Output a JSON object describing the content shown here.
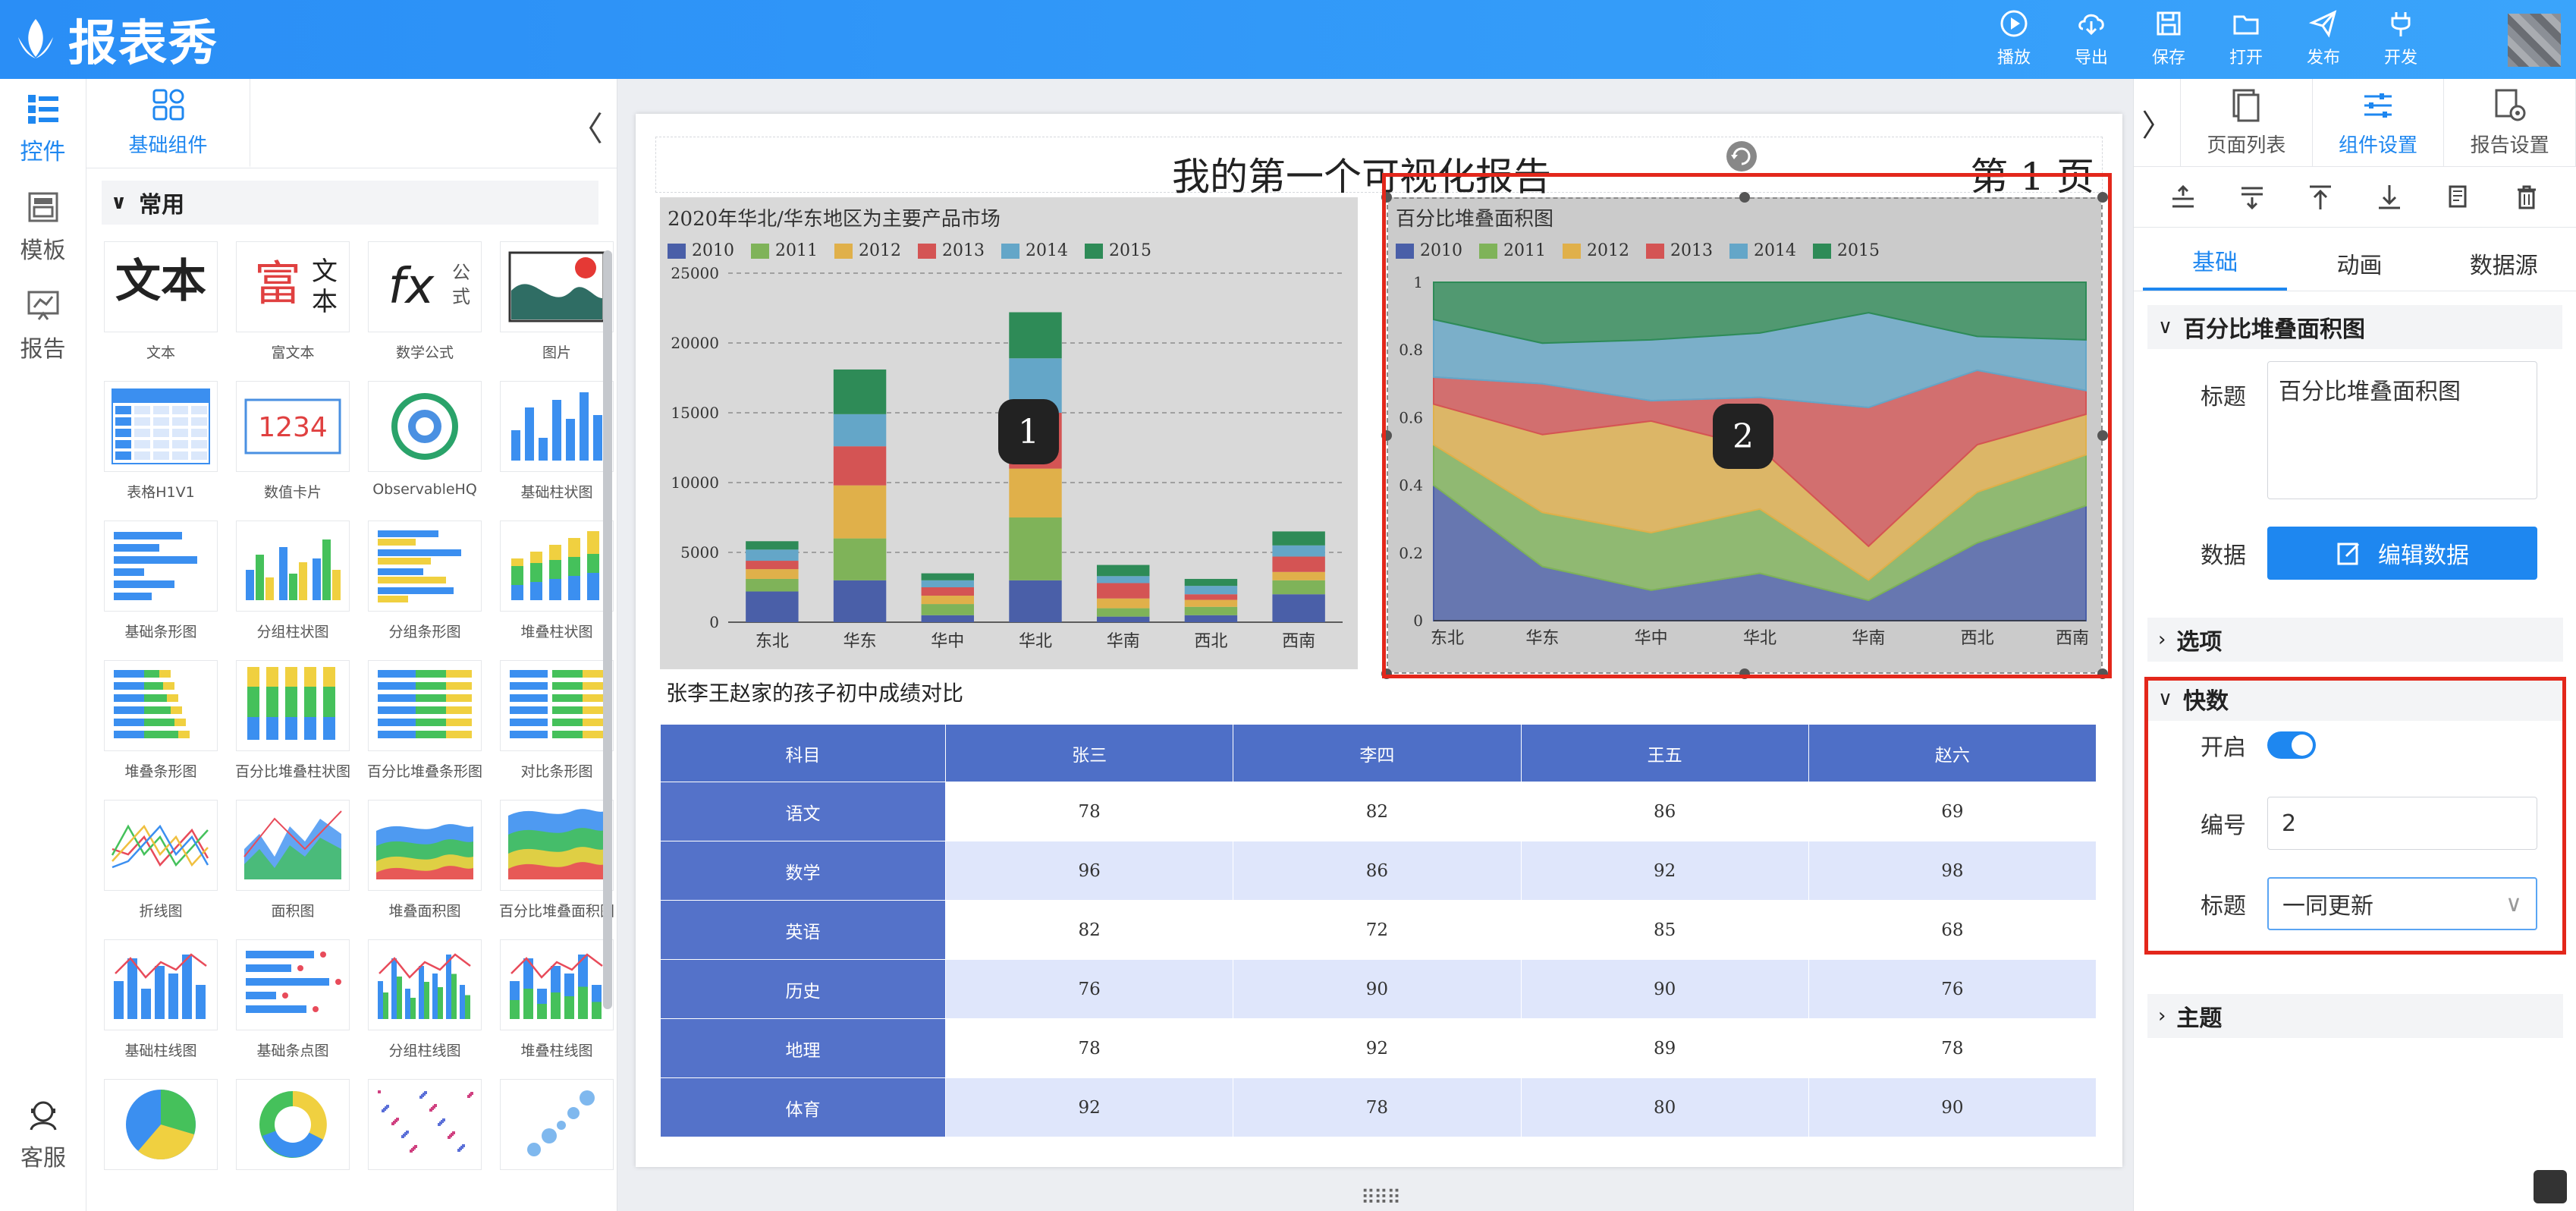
{
  "app": {
    "title": "报表秀"
  },
  "toolbar": [
    {
      "label": "播放",
      "icon": "play-icon"
    },
    {
      "label": "导出",
      "icon": "export-icon"
    },
    {
      "label": "保存",
      "icon": "save-icon"
    },
    {
      "label": "打开",
      "icon": "open-folder-icon"
    },
    {
      "label": "发布",
      "icon": "publish-icon"
    },
    {
      "label": "开发",
      "icon": "plug-icon"
    }
  ],
  "rail": {
    "items": [
      "控件",
      "模板",
      "报告"
    ],
    "bottom": "客服"
  },
  "components": {
    "tab": "基础组件",
    "section": "常用",
    "items": [
      "文本",
      "富文本",
      "数学公式",
      "图片",
      "表格H1V1",
      "数值卡片",
      "ObservableHQ",
      "基础柱状图",
      "基础条形图",
      "分组柱状图",
      "分组条形图",
      "堆叠柱状图",
      "堆叠条形图",
      "百分比堆叠柱状图",
      "百分比堆叠条形图",
      "对比条形图",
      "折线图",
      "面积图",
      "堆叠面积图",
      "百分比堆叠面积图",
      "基础柱线图",
      "基础条点图",
      "分组柱线图",
      "堆叠柱线图",
      "",
      "",
      "",
      ""
    ],
    "thumb_text": {
      "wenben": "文本",
      "fu": "富",
      "fu2": "文",
      "fu3": "本",
      "fx": "fx",
      "gongshi1": "公",
      "gongshi2": "式",
      "card": "1234"
    }
  },
  "report": {
    "title": "我的第一个可视化报告",
    "page_label": "第  1  页",
    "badges": [
      "1",
      "2"
    ]
  },
  "colors": {
    "2010": "#4a5fa8",
    "2011": "#7fb359",
    "2012": "#e0b04a",
    "2013": "#d45454",
    "2014": "#64a6c8",
    "2015": "#2e8b57",
    "accent": "#1e87f0",
    "highlight": "#e3271b"
  },
  "chart_data": [
    {
      "type": "bar",
      "stacked": true,
      "title": "2020年华北/华东地区为主要产品市场",
      "categories": [
        "东北",
        "华东",
        "华中",
        "华北",
        "华南",
        "西北",
        "西南"
      ],
      "series": [
        {
          "name": "2010",
          "values": [
            2200,
            3000,
            500,
            3000,
            400,
            500,
            2000
          ]
        },
        {
          "name": "2011",
          "values": [
            900,
            3000,
            800,
            4500,
            600,
            600,
            1000
          ]
        },
        {
          "name": "2012",
          "values": [
            700,
            3800,
            600,
            3500,
            700,
            500,
            600
          ]
        },
        {
          "name": "2013",
          "values": [
            600,
            2800,
            600,
            4000,
            1100,
            400,
            1100
          ]
        },
        {
          "name": "2014",
          "values": [
            800,
            2300,
            500,
            3900,
            500,
            600,
            800
          ]
        },
        {
          "name": "2015",
          "values": [
            600,
            3200,
            500,
            3300,
            800,
            500,
            1000
          ]
        }
      ],
      "yticks": [
        "0",
        "5000",
        "10000",
        "15000",
        "20000",
        "25000"
      ],
      "ylim": [
        0,
        25000
      ]
    },
    {
      "type": "area",
      "stacked": "percent",
      "title": "百分比堆叠面积图",
      "categories": [
        "东北",
        "华东",
        "华中",
        "华北",
        "华南",
        "西北",
        "西南"
      ],
      "series": [
        {
          "name": "2010",
          "values": [
            0.4,
            0.16,
            0.09,
            0.14,
            0.06,
            0.23,
            0.34
          ]
        },
        {
          "name": "2011",
          "values": [
            0.12,
            0.16,
            0.17,
            0.19,
            0.06,
            0.15,
            0.15
          ]
        },
        {
          "name": "2012",
          "values": [
            0.12,
            0.23,
            0.33,
            0.18,
            0.1,
            0.14,
            0.12
          ]
        },
        {
          "name": "2013",
          "values": [
            0.08,
            0.15,
            0.06,
            0.15,
            0.41,
            0.22,
            0.07
          ]
        },
        {
          "name": "2014",
          "values": [
            0.17,
            0.12,
            0.18,
            0.19,
            0.28,
            0.1,
            0.15
          ]
        },
        {
          "name": "2015",
          "values": [
            0.11,
            0.18,
            0.17,
            0.15,
            0.09,
            0.16,
            0.17
          ]
        }
      ],
      "yticks": [
        "0",
        "0.2",
        "0.4",
        "0.6",
        "0.8",
        "1"
      ],
      "ylim": [
        0,
        1
      ]
    }
  ],
  "table": {
    "title": "张李王赵家的孩子初中成绩对比",
    "headers": [
      "科目",
      "张三",
      "李四",
      "王五",
      "赵六"
    ],
    "rows": [
      [
        "语文",
        "78",
        "82",
        "86",
        "69"
      ],
      [
        "数学",
        "96",
        "86",
        "92",
        "98"
      ],
      [
        "英语",
        "82",
        "72",
        "85",
        "68"
      ],
      [
        "历史",
        "76",
        "90",
        "90",
        "76"
      ],
      [
        "地理",
        "78",
        "92",
        "89",
        "78"
      ],
      [
        "体育",
        "92",
        "78",
        "80",
        "90"
      ]
    ]
  },
  "settings": {
    "tabs": [
      "页面列表",
      "组件设置",
      "报告设置"
    ],
    "sub_tabs": [
      "基础",
      "动画",
      "数据源"
    ],
    "component_name": "百分比堆叠面积图",
    "title_label": "标题",
    "title_value": "百分比堆叠面积图",
    "data_label": "数据",
    "edit_data": "编辑数据",
    "options": "选项",
    "snapshot": {
      "section": "快数",
      "enable_label": "开启",
      "enabled": true,
      "number_label": "编号",
      "number_value": "2",
      "title_label": "标题",
      "title_value": "一同更新"
    },
    "theme": "主题"
  }
}
